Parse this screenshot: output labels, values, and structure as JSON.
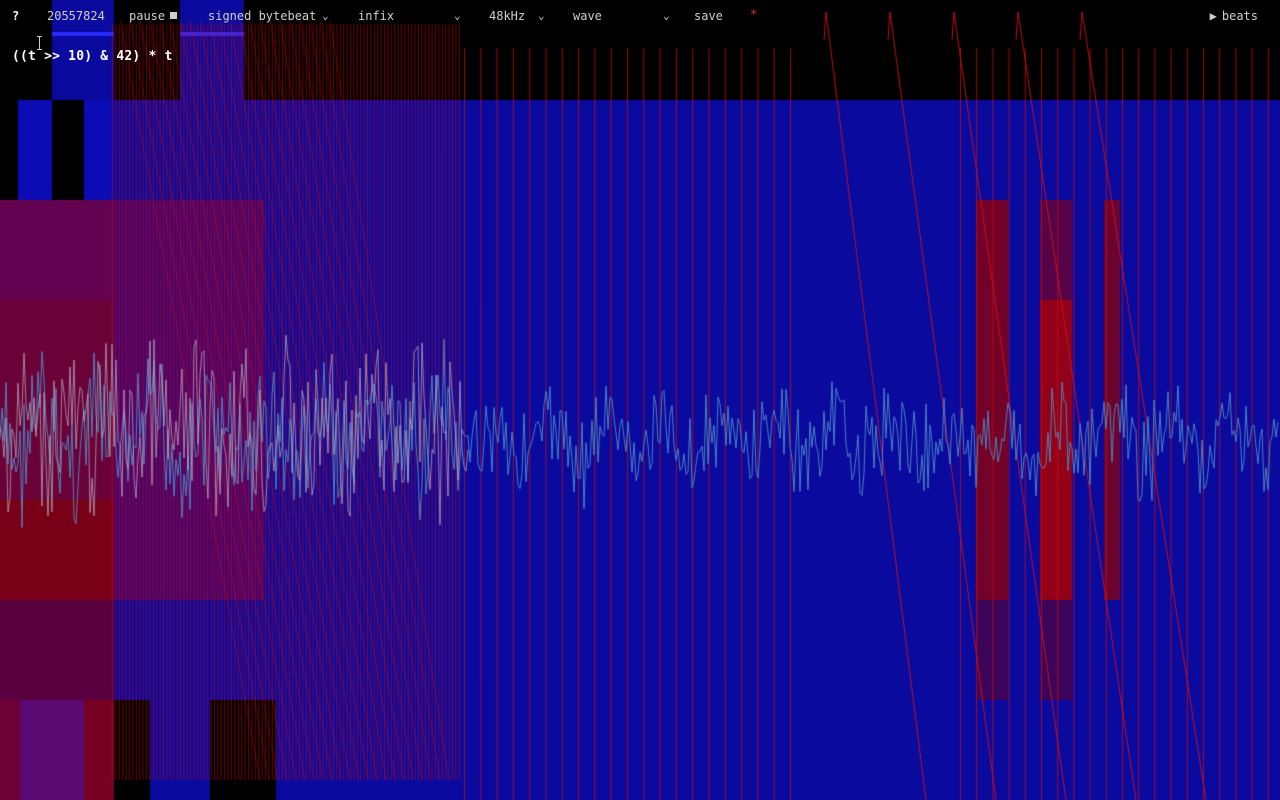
{
  "toolbar": {
    "help": "?",
    "counter": "20557824",
    "pause_label": "pause",
    "mode_select": "signed bytebeat",
    "syntax_select": "infix",
    "samplerate_select": "48kHz",
    "view_select": "wave",
    "save_label": "save",
    "beats_label": "beats"
  },
  "editor": {
    "code": "((t >> 10) & 42) * t"
  },
  "colors": {
    "background": "#000000",
    "spectrum_blue": "#0a0a9e",
    "waveform_red": "#c01010",
    "waveform_trace": "#3a7ab0",
    "toolbar_text": "#cfcfcf",
    "record_dot": "#e03030"
  },
  "icons": {
    "stop": "stop-square-icon",
    "chevron": "chevron-down-icon",
    "play": "play-triangle-icon",
    "text_cursor": "text-cursor-icon"
  }
}
